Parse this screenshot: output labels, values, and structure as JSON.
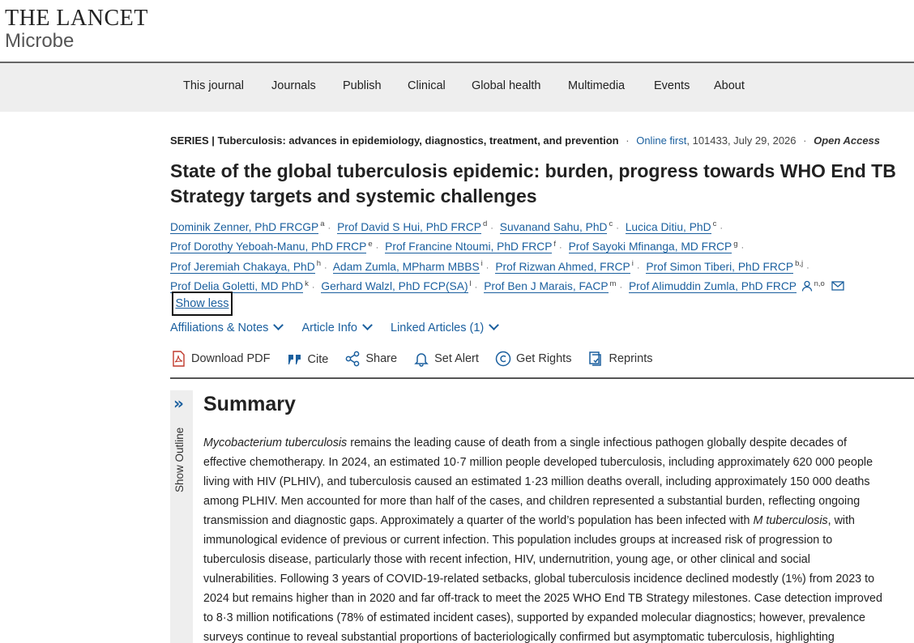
{
  "logo": {
    "main": "THE LANCET",
    "sub": "Microbe"
  },
  "nav": [
    "This journal",
    "Journals",
    "Publish",
    "Clinical",
    "Global health",
    "Multimedia",
    "Events",
    "About"
  ],
  "meta": {
    "series": "SERIES | Tuberculosis: advances in epidemiology, diagnostics, treatment, and prevention",
    "online_first": "Online first",
    "ref": ", 101433, July 29, 2026",
    "open_access": "Open Access"
  },
  "title": "State of the global tuberculosis epidemic: burden, progress towards WHO End TB Strategy targets and systemic challenges",
  "author_lines": [
    [
      {
        "name": "Dominik Zenner, PhD FRCGP",
        "sup": "a"
      },
      {
        "name": "Prof David S Hui, PhD FRCP",
        "sup": "d"
      },
      {
        "name": "Suvanand Sahu, PhD",
        "sup": "c"
      },
      {
        "name": "Lucica Ditiu, PhD",
        "sup": "c"
      }
    ],
    [
      {
        "name": "Prof Dorothy Yeboah-Manu, PhD FRCP",
        "sup": "e"
      },
      {
        "name": "Prof Francine Ntoumi, PhD FRCP",
        "sup": "f"
      },
      {
        "name": "Prof Sayoki Mfinanga, MD FRCP",
        "sup": "g"
      }
    ],
    [
      {
        "name": "Prof Jeremiah Chakaya, PhD",
        "sup": "h"
      },
      {
        "name": "Adam Zumla, MPharm MBBS",
        "sup": "i"
      },
      {
        "name": "Prof Rizwan Ahmed, FRCP",
        "sup": "i"
      },
      {
        "name": "Prof Simon Tiberi, PhD FRCP",
        "sup": "b,j"
      }
    ],
    [
      {
        "name": "Prof Delia Goletti, MD PhD",
        "sup": "k"
      },
      {
        "name": "Gerhard Walzl, PhD FCP(SA)",
        "sup": "l"
      },
      {
        "name": "Prof Ben J Marais, FACP",
        "sup": "m"
      },
      {
        "name": "Prof Alimuddin Zumla, PhD FRCP",
        "sup": "n,o"
      }
    ]
  ],
  "show_less": "Show less",
  "toggles": [
    "Affiliations & Notes",
    "Article Info",
    "Linked Articles (1)"
  ],
  "tools": [
    {
      "label": "Download PDF",
      "icon": "pdf-icon"
    },
    {
      "label": "Cite",
      "icon": "quote-icon"
    },
    {
      "label": "Share",
      "icon": "share-icon"
    },
    {
      "label": "Set Alert",
      "icon": "bell-icon"
    },
    {
      "label": "Get Rights",
      "icon": "copyright-icon"
    },
    {
      "label": "Reprints",
      "icon": "reprint-icon"
    }
  ],
  "outline_label": "Show Outline",
  "summary_title": "Summary",
  "summary_lines": [
    "remains the leading cause of death from a single infectious pathogen globally despite decades of",
    "effective chemotherapy. In 2024, an estimated 10·7 million people developed tuberculosis, including approximately 620 000 people",
    "living with HIV (PLHIV), and tuberculosis caused an estimated 1·23 million deaths overall, including approximately 150 000 deaths",
    "among PLHIV. Men accounted for more than half of the cases, and children represented a substantial burden, reflecting ongoing",
    "transmission and diagnostic gaps. Approximately a quarter of the world’s population has been infected with",
    "immunological evidence of previous or current infection. This population includes groups at increased risk of progression to",
    "tuberculosis disease, particularly those with recent infection, HIV, undernutrition, young age, or other clinical and social",
    "vulnerabilities. Following 3 years of COVID-19-related setbacks, global tuberculosis incidence declined modestly (1%) from 2023 to",
    "2024 but remains higher than in 2020 and far off-track to meet the 2025 WHO End TB Strategy milestones. Case detection improved",
    "to 8·3 million notifications (78% of estimated incident cases), supported by expanded molecular diagnostics; however, prevalence",
    "surveys continue to reveal substantial proportions of bacteriologically confirmed but asymptomatic tuberculosis, highlighting"
  ],
  "summary_italic_start": "Mycobacterium tuberculosis",
  "summary_italic_mid": "M tuberculosis",
  "summary_tail_mid": ", with"
}
